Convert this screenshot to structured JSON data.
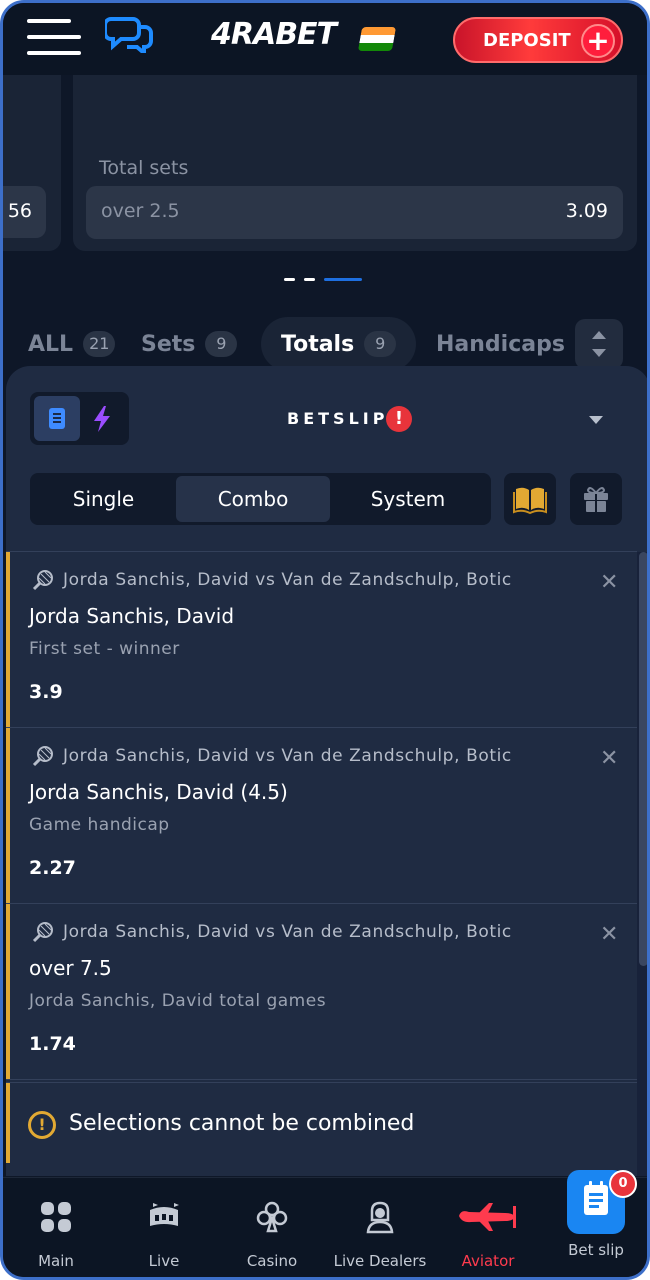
{
  "header": {
    "logo_text": "4RABET",
    "deposit_label": "DEPOSIT",
    "deposit_plus": "+"
  },
  "market": {
    "title": "Total sets",
    "left_odd_fragment": "56",
    "odd_label": "over 2.5",
    "odd_value": "3.09"
  },
  "filters": [
    {
      "label": "ALL",
      "count": "21"
    },
    {
      "label": "Sets",
      "count": "9"
    },
    {
      "label": "Totals",
      "count": "9"
    },
    {
      "label": "Handicaps",
      "count": ""
    }
  ],
  "betslip": {
    "title": "BETSLIP",
    "alert": "!",
    "types": [
      "Single",
      "Combo",
      "System"
    ],
    "active_type": "Combo",
    "bets": [
      {
        "match": "Jorda Sanchis, David vs Van de Zandschulp, Botic",
        "selection": "Jorda Sanchis, David",
        "market": "First set - winner",
        "odd": "3.9"
      },
      {
        "match": "Jorda Sanchis, David vs Van de Zandschulp, Botic",
        "selection": "Jorda Sanchis, David (4.5)",
        "market": "Game handicap",
        "odd": "2.27"
      },
      {
        "match": "Jorda Sanchis, David vs Van de Zandschulp, Botic",
        "selection": "over 7.5",
        "market": "Jorda Sanchis, David total games",
        "odd": "1.74"
      }
    ],
    "close_glyph": "✕",
    "warning": "Selections cannot be combined",
    "warning_icon": "!"
  },
  "nav": {
    "items": [
      {
        "label": "Main",
        "icon": "grid-icon"
      },
      {
        "label": "Live",
        "icon": "stadium-icon"
      },
      {
        "label": "Casino",
        "icon": "club-icon"
      },
      {
        "label": "Live Dealers",
        "icon": "dealer-icon"
      },
      {
        "label": "Aviator",
        "icon": "plane-icon"
      }
    ],
    "betslip_label": "Bet slip",
    "betslip_count": "0"
  },
  "colors": {
    "accent_blue": "#1a86f2",
    "deposit_red": "#ff3b3b",
    "warning_amber": "#e2a933",
    "aviator_red": "#ff3b4e"
  }
}
